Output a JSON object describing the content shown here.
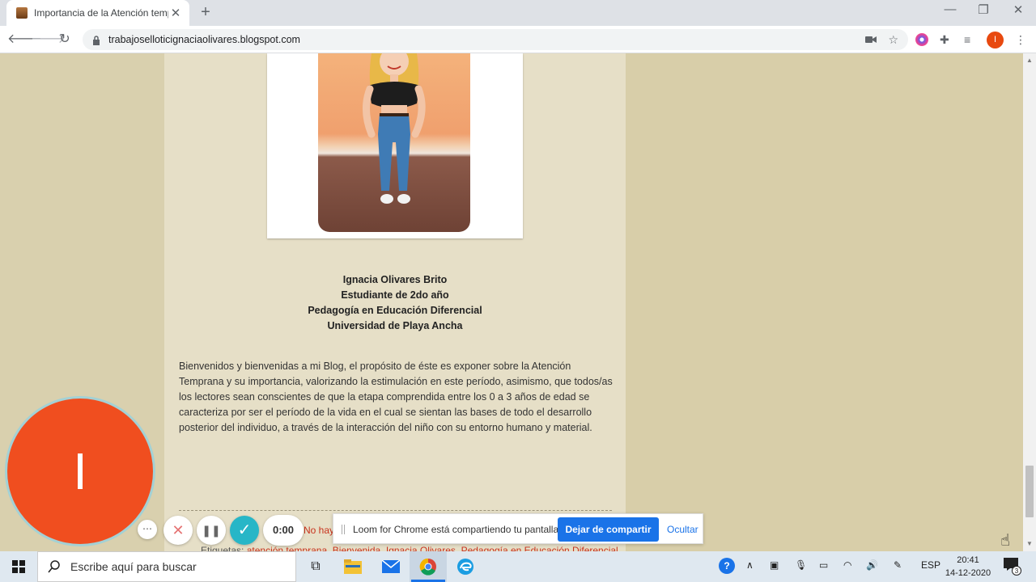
{
  "browser": {
    "tab_title": "Importancia de la Atención temp",
    "url": "trabajoselloticignaciaolivares.blogspot.com",
    "profile_initial": "I"
  },
  "post": {
    "bio_lines": [
      "Ignacia Olivares Brito",
      "Estudiante de 2do año",
      "Pedagogía en Educación Diferencial",
      "Universidad de Playa Ancha"
    ],
    "paragraph": "Bienvenidos y bienvenidas a mi Blog, el propósito de éste es exponer sobre la Atención Temprana y su importancia, valorizando la estimulación en este período, asimismo, que todos/as los lectores sean conscientes de que la etapa comprendida entre los 0 a 3 años de edad se caracteriza por ser el período de la vida en el cual se sientan las bases de todo el desarrollo posterior del individuo, a través de la interacción del niño con su entorno humano y material.",
    "comments_text": "No hay",
    "labels_prefix": "Etiquetas:",
    "labels": [
      "atención temprana",
      "Bienvenida",
      "Ignacia Olivares",
      "Pedagogía en Educación Diferencial"
    ]
  },
  "loom": {
    "avatar_initial": "I",
    "timer": "0:00",
    "banner_message": "Loom for Chrome está compartiendo tu pantalla.",
    "stop_label": "Dejar de compartir",
    "hide_label": "Ocultar"
  },
  "taskbar": {
    "search_placeholder": "Escribe aquí para buscar",
    "language": "ESP",
    "time": "20:41",
    "date": "14-12-2020",
    "notification_count": "3"
  },
  "colors": {
    "accent": "#1a73e8",
    "link": "#c8321d",
    "loom_orange": "#f04e1f"
  }
}
